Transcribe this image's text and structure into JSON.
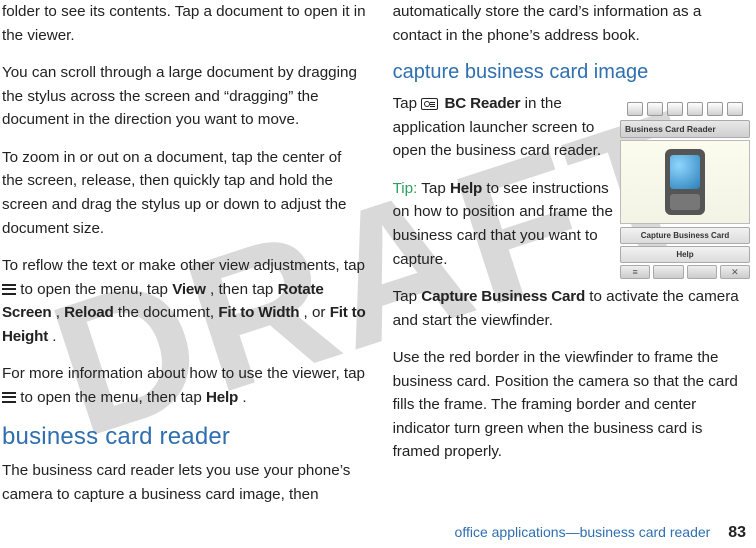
{
  "watermark": "DRAFT",
  "left": {
    "p1": "folder to see its contents. Tap a document to open it in the viewer.",
    "p2": "You can scroll through a large document by dragging the stylus across the screen and “dragging” the document in the direction you want to move.",
    "p3": "To zoom in or out on a document, tap the center of the screen, release, then quickly tap and hold the screen and drag the stylus up or down to adjust the document size.",
    "p4a": "To reflow the text or make other view adjustments, tap ",
    "p4b": " to open the menu, tap ",
    "p4_view": "View",
    "p4c": ", then tap ",
    "p4_rotate": "Rotate Screen",
    "p4d": ", ",
    "p4_reload": "Reload",
    "p4e": " the document, ",
    "p4_fitw": "Fit to Width",
    "p4f": ", or ",
    "p4_fith": "Fit to Height",
    "p4g": ".",
    "p5a": "For more information about how to use the viewer, tap ",
    "p5b": " to open the menu, then tap ",
    "p5_help": "Help",
    "p5c": ".",
    "h2": "business card reader",
    "p6": "The business card reader lets you use your phone’s camera to capture a business card image, then "
  },
  "right": {
    "p1": "automatically store the card’s information as a contact in the phone’s address book.",
    "h3": "capture business card image",
    "p2a": "Tap ",
    "p2_bcreader": "BC Reader",
    "p2b": " in the application launcher screen to open the business card reader.",
    "tip_label": "Tip:",
    "p3a": " Tap ",
    "p3_help": "Help",
    "p3b": " to see instructions on how to position and frame the business card that you want to capture.",
    "p4a": "Tap ",
    "p4_capture": "Capture Business Card",
    "p4b": " to activate the camera and start the viewfinder.",
    "p5": "Use the red border in the viewfinder to frame the business card. Position the camera so that the card fills the frame. The framing border and center indicator turn green when the business card is framed properly."
  },
  "mock": {
    "title": "Business Card Reader",
    "btn_capture": "Capture Business Card",
    "btn_help": "Help",
    "close": "✕",
    "menu": "≡"
  },
  "footer": {
    "text": "office applications—business card reader",
    "page": "83"
  }
}
